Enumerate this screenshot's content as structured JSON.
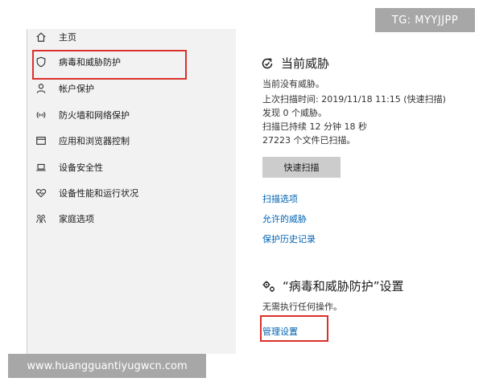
{
  "sidebar": {
    "items": [
      {
        "label": "主页",
        "icon": "home-icon"
      },
      {
        "label": "病毒和威胁防护",
        "icon": "shield-icon"
      },
      {
        "label": "帐户保护",
        "icon": "person-icon"
      },
      {
        "label": "防火墙和网络保护",
        "icon": "wifi-icon"
      },
      {
        "label": "应用和浏览器控制",
        "icon": "window-icon"
      },
      {
        "label": "设备安全性",
        "icon": "laptop-icon"
      },
      {
        "label": "设备性能和运行状况",
        "icon": "heart-icon"
      },
      {
        "label": "家庭选项",
        "icon": "family-icon"
      }
    ]
  },
  "threats": {
    "title": "当前威胁",
    "lines": [
      "当前没有威胁。",
      "上次扫描时间: 2019/11/18 11:15 (快速扫描)",
      "发现 0 个威胁。",
      "扫描已持续 12 分钟 18 秒",
      "27223 个文件已扫描。"
    ],
    "scan_button": "快速扫描",
    "links": [
      "扫描选项",
      "允许的威胁",
      "保护历史记录"
    ]
  },
  "settings": {
    "title": "“病毒和威胁防护”设置",
    "desc": "无需执行任何操作。",
    "manage_link": "管理设置"
  },
  "watermarks": {
    "tg": "TG: MYYJJPP",
    "url": "www.huangguantiyugwcn.com"
  },
  "colors": {
    "accent_link": "#0063b1",
    "highlight_red": "#d9312b",
    "sidebar_bg": "#f2f2f2",
    "button_bg": "#cccccc"
  }
}
